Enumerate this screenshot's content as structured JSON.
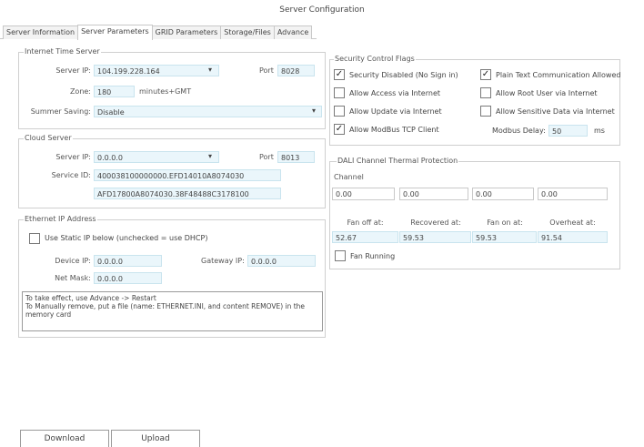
{
  "window": {
    "title": "Server Configuration"
  },
  "tabs": [
    "Server Information",
    "Server Parameters",
    "GRID Parameters",
    "Storage/Files",
    "Advance"
  ],
  "internet_time": {
    "title": "Internet Time Server",
    "server_ip_label": "Server IP:",
    "server_ip": "104.199.228.164",
    "port_label": "Port",
    "port": "8028",
    "zone_label": "Zone:",
    "zone": "180",
    "zone_suffix": "minutes+GMT",
    "summer_label": "Summer Saving:",
    "summer": "Disable"
  },
  "cloud": {
    "title": "Cloud Server",
    "server_ip_label": "Server IP:",
    "server_ip": "0.0.0.0",
    "port_label": "Port",
    "port": "8013",
    "service_id_label": "Service ID:",
    "service_id_1": "400038100000000.EFD14010A8074030",
    "service_id_2": "AFD17800A8074030.38F48488C3178100"
  },
  "ethernet": {
    "title": "Ethernet IP Address",
    "static_ip_label": "Use Static IP below (unchecked = use DHCP)",
    "static_ip_checked": false,
    "device_ip_label": "Device IP:",
    "device_ip": "0.0.0.0",
    "gateway_label": "Gateway IP:",
    "gateway": "0.0.0.0",
    "netmask_label": "Net Mask:",
    "netmask": "0.0.0.0",
    "note_1": "To take effect, use Advance -> Restart",
    "note_2": "To Manually remove, put a file (name: ETHERNET.INI, and content REMOVE) in the memory card"
  },
  "security": {
    "title": "Security Control Flags",
    "flags": [
      {
        "label": "Security Disabled (No Sign in)",
        "checked": true
      },
      {
        "label": "Plain Text Communication Allowed",
        "checked": true
      },
      {
        "label": "Allow Access via Internet",
        "checked": false
      },
      {
        "label": "Allow Root User via Internet",
        "checked": false
      },
      {
        "label": "Allow Update via Internet",
        "checked": false
      },
      {
        "label": "Allow Sensitive Data via Internet",
        "checked": false
      },
      {
        "label": "Allow ModBus TCP Client",
        "checked": true
      }
    ],
    "modbus_delay_label": "Modbus Delay:",
    "modbus_delay": "50",
    "modbus_delay_unit": "ms"
  },
  "dali": {
    "title": "DALI Channel Thermal Protection",
    "channel_label": "Channel",
    "channels": [
      "0.00",
      "0.00",
      "0.00",
      "0.00"
    ],
    "headers": [
      "Fan off at:",
      "Recovered at:",
      "Fan on at:",
      "Overheat at:"
    ],
    "values": [
      "52.67",
      "59.53",
      "59.53",
      "91.54"
    ],
    "fan_running_label": "Fan Running",
    "fan_running": false
  },
  "buttons": {
    "download": "Download",
    "upload": "Upload"
  }
}
